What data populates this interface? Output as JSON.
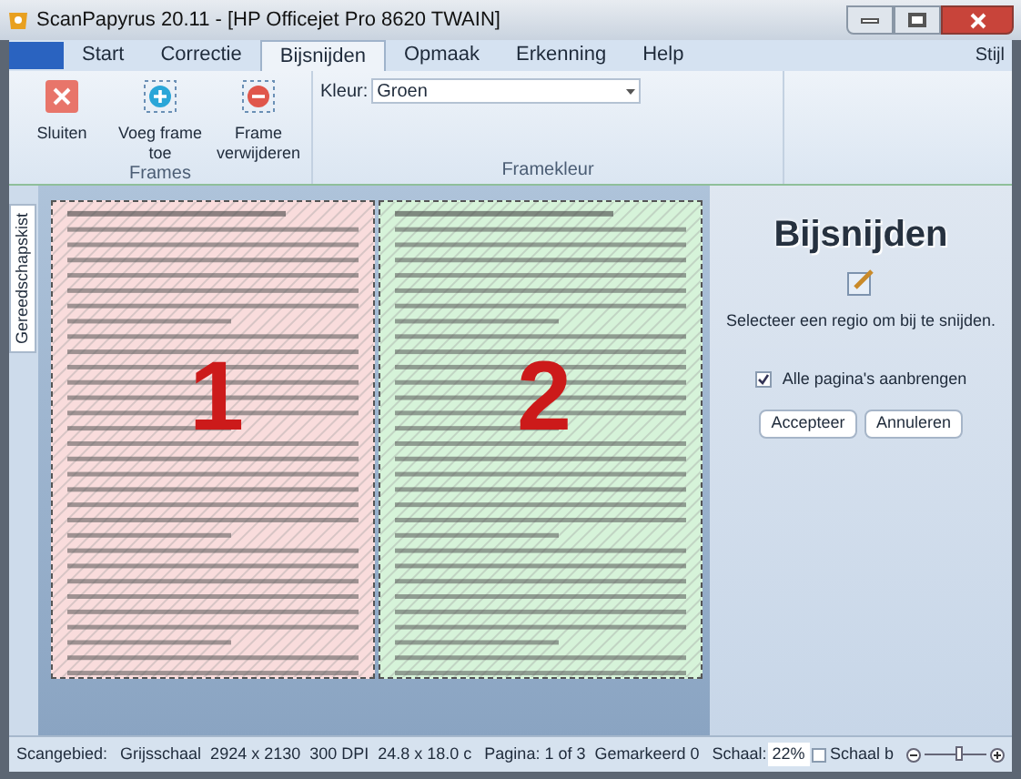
{
  "window": {
    "title": "ScanPapyrus 20.11 - [HP Officejet Pro 8620 TWAIN]"
  },
  "tabs": [
    {
      "label": "Start",
      "selected": false
    },
    {
      "label": "Correctie",
      "selected": false
    },
    {
      "label": "Bijsnijden",
      "selected": true
    },
    {
      "label": "Opmaak",
      "selected": false
    },
    {
      "label": "Erkenning",
      "selected": false
    },
    {
      "label": "Help",
      "selected": false
    }
  ],
  "style_menu": "Stijl",
  "ribbon": {
    "groups": [
      {
        "label": "Frames",
        "buttons": [
          {
            "kind": "close",
            "label": "Sluiten"
          },
          {
            "kind": "add",
            "label": "Voeg frame toe"
          },
          {
            "kind": "remove",
            "label": "Frame verwijderen"
          }
        ]
      },
      {
        "label": "Framekleur",
        "color_label": "Kleur:",
        "color_value": "Groen"
      }
    ]
  },
  "side_tab": "Gereedschapskist",
  "frames": [
    {
      "number": "1",
      "color": "#f9dcdc"
    },
    {
      "number": "2",
      "color": "#d6f3d9"
    }
  ],
  "panel": {
    "title": "Bijsnijden",
    "instruction": "Selecteer een regio om bij te snijden.",
    "apply_all": {
      "label": "Alle pagina's aanbrengen",
      "checked": true
    },
    "buttons": [
      "Accepteer",
      "Annuleren"
    ]
  },
  "status_bar": {
    "area_label": "Scangebied:",
    "scan_info": "Grijsschaal  2924 x 2130  300 DPI  24.8 x 18.0 c",
    "page_info": "Pagina: 1 of 3  Gemarkeerd 0",
    "scale_label": "Schaal:",
    "scale_value": "22%",
    "fit": {
      "label": "Schaal b",
      "checked": false
    },
    "zoom": {
      "level": 0.55
    }
  }
}
